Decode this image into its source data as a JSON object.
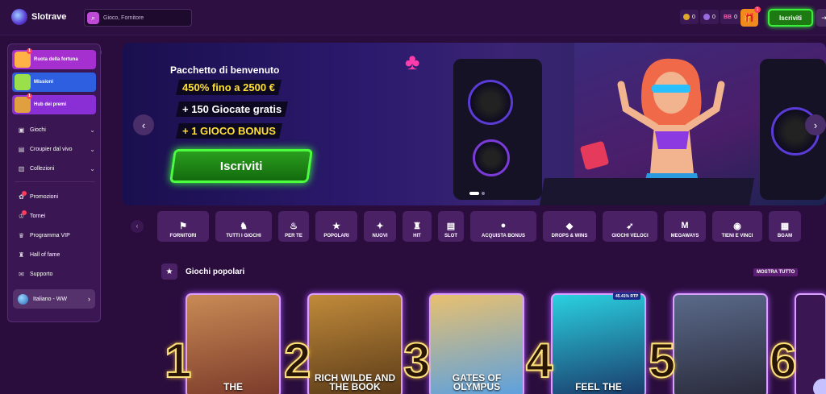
{
  "brand": {
    "name": "Slotrave"
  },
  "search": {
    "placeholder": "Gioco, Fornitore"
  },
  "wallet": {
    "coins": "0",
    "spins": "0",
    "bonus": "BB",
    "bonus_count": "0"
  },
  "header": {
    "register_label": "Iscriviti",
    "gift_count": "1"
  },
  "sidebar": {
    "promos": [
      {
        "label": "Ruota della fortuna",
        "badge": "1",
        "color": "#a52fcf"
      },
      {
        "label": "Missioni",
        "badge": "",
        "color": "#2d5fe0"
      },
      {
        "label": "Hub dei premi",
        "badge": "1",
        "color": "#8a2fd6"
      }
    ],
    "menu": [
      {
        "label": "Giochi",
        "icon": "gamepad-icon"
      },
      {
        "label": "Croupier dal vivo",
        "icon": "cards-icon"
      },
      {
        "label": "Collezioni",
        "icon": "folder-icon"
      }
    ],
    "links": [
      {
        "label": "Promozioni",
        "icon": "gift-icon"
      },
      {
        "label": "Tornei",
        "icon": "trophy-icon"
      },
      {
        "label": "Programma VIP",
        "icon": "crown-icon"
      },
      {
        "label": "Hall of fame",
        "icon": "hall-icon"
      },
      {
        "label": "Supporto",
        "icon": "chat-icon"
      }
    ],
    "language": "Italiano - WW"
  },
  "hero": {
    "title": "Pacchetto di benvenuto",
    "line1": "450% fino a 2500 €",
    "line2": "+ 150 Giocate gratis",
    "line3": "+ 1 GIOCO BONUS",
    "cta": "Iscriviti",
    "slides_total": 2,
    "slide_active": 1
  },
  "categories": [
    {
      "label": "FORNITORI",
      "icon": "flag-icon",
      "glyph": "⚑"
    },
    {
      "label": "TUTTI I GIOCHI",
      "icon": "unicorn-icon",
      "glyph": "♞"
    },
    {
      "label": "PER TE",
      "icon": "thumb-icon",
      "glyph": "♨"
    },
    {
      "label": "POPOLARI",
      "icon": "star-icon",
      "glyph": "★"
    },
    {
      "label": "NUOVI",
      "icon": "sparkle-icon",
      "glyph": "✦"
    },
    {
      "label": "HIT",
      "icon": "joystick-icon",
      "glyph": "♜"
    },
    {
      "label": "SLOT",
      "icon": "slot-icon",
      "glyph": "▤"
    },
    {
      "label": "ACQUISTA BONUS",
      "icon": "coin-icon",
      "glyph": "●"
    },
    {
      "label": "DROPS & WINS",
      "icon": "chest-icon",
      "glyph": "◆"
    },
    {
      "label": "GIOCHI VELOCI",
      "icon": "rocket-icon",
      "glyph": "➶"
    },
    {
      "label": "MEGAWAYS",
      "icon": "m-icon",
      "glyph": "M"
    },
    {
      "label": "TIENI E VINCI",
      "icon": "pot-icon",
      "glyph": "◉"
    },
    {
      "label": "BGAM",
      "icon": "game-icon",
      "glyph": "▦"
    }
  ],
  "section": {
    "title": "Giochi popolari",
    "show_all": "MOSTRA TUTTO"
  },
  "games": [
    {
      "rank": "1",
      "name": "THE",
      "colors": [
        "#7a3a2a",
        "#c98a55"
      ]
    },
    {
      "rank": "2",
      "name": "RICH WILDE AND THE BOOK",
      "colors": [
        "#5a3a18",
        "#c08a3a"
      ]
    },
    {
      "rank": "3",
      "name": "GATES OF OLYMPUS",
      "colors": [
        "#5aa0e0",
        "#e8c070"
      ]
    },
    {
      "rank": "4",
      "name": "FEEL THE",
      "colors": [
        "#1a3a6a",
        "#2ad0e0"
      ],
      "rtp": "45.41% RTP"
    },
    {
      "rank": "5",
      "name": "",
      "colors": [
        "#2a2a3a",
        "#5a6a8a"
      ]
    },
    {
      "rank": "6",
      "name": "",
      "colors": [
        "#3a1652",
        "#3a1652"
      ]
    }
  ]
}
